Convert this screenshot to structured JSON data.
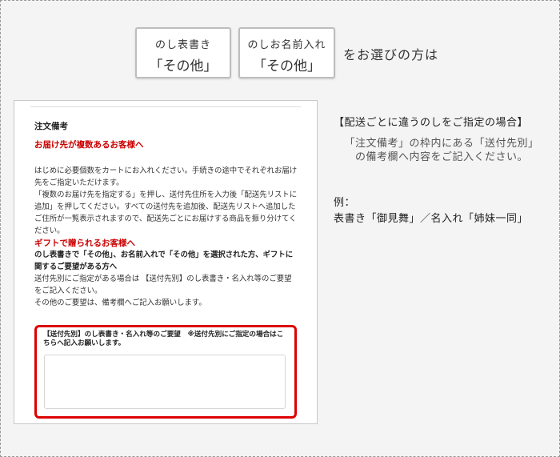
{
  "options": [
    {
      "line1": "のし表書き",
      "line2": "「その他」"
    },
    {
      "line1": "のしお名前入れ",
      "line2": "「その他」"
    }
  ],
  "choose_text": "をお選びの方は",
  "form": {
    "title": "注文備考",
    "heading_multiple": "お届け先が複数あるお客様へ",
    "para_multiple": [
      "はじめに必要個数をカートにお入れください。手続きの途中でそれぞれお届け先をご指定いただけます。",
      "「複数のお届け先を指定する」を押し、送付先住所を入力後「配送先リストに追加」を押してください。すべての送付先を追加後、配送先リストへ追加したご住所が一覧表示されますので、配送先ごとにお届けする商品を振り分けてください。"
    ],
    "heading_gift": "ギフトで贈られるお客様へ",
    "gift_bold": "のし表書きで「その他」、お名前入れで「その他」を選択された方、ギフトに関するご要望がある方へ",
    "para_gift": [
      "送付先別にご指定がある場合は 【送付先別】のし表書き・名入れ等のご要望をご記入ください。",
      "その他のご要望は、備考欄へご記入お願いします。"
    ],
    "box_label": "【送付先別】のし表書き・名入れ等のご要望　※送付先別にご指定の場合はこちらへ記入お願いします。",
    "textarea_value": ""
  },
  "right": {
    "heading": "【配送ごとに違うのしをご指定の場合】",
    "note": [
      "「注文備考」の枠内にある「送付先別」",
      "の備考欄へ内容をご記入ください。"
    ],
    "example_label": "例：",
    "example_text": "表書き「御見舞」／名入れ「姉妹一同」"
  },
  "colors": {
    "accent_red": "#dd0000",
    "heading_red": "#cc0000",
    "background": "#f4f4f4"
  }
}
